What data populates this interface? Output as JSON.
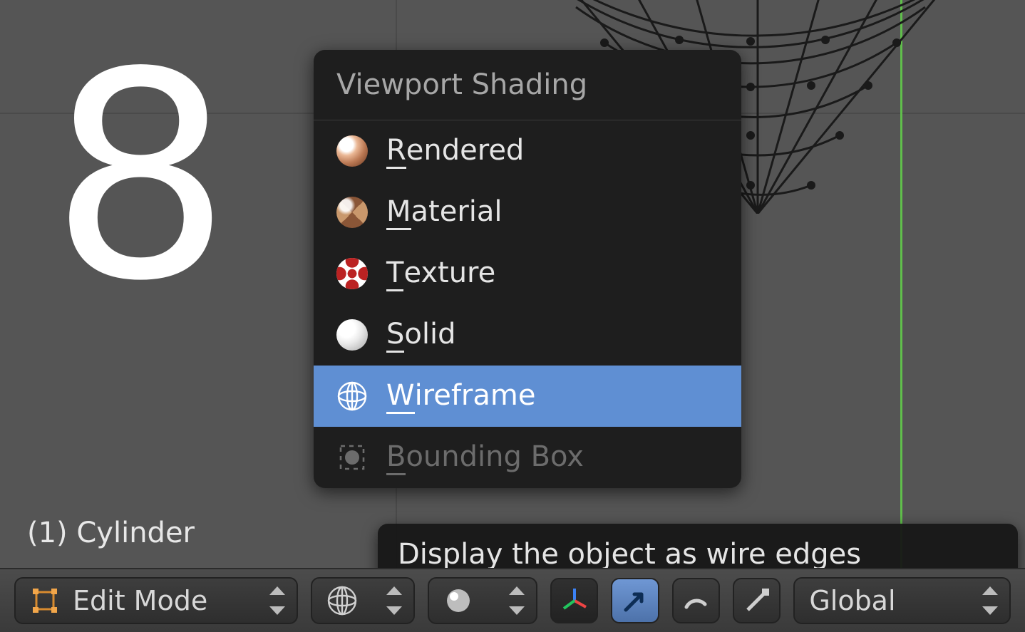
{
  "overlay_number": "8",
  "object_name": "(1) Cylinder",
  "popup": {
    "title": "Viewport Shading",
    "items": [
      {
        "label_pre": "",
        "ul": "R",
        "label_post": "endered",
        "icon": "rendered"
      },
      {
        "label_pre": "",
        "ul": "M",
        "label_post": "aterial",
        "icon": "material"
      },
      {
        "label_pre": "",
        "ul": "T",
        "label_post": "exture",
        "icon": "texture"
      },
      {
        "label_pre": "",
        "ul": "S",
        "label_post": "olid",
        "icon": "solid"
      },
      {
        "label_pre": "",
        "ul": "W",
        "label_post": "ireframe",
        "icon": "wire",
        "selected": true
      },
      {
        "label_pre": "",
        "ul": "B",
        "label_post": "ounding Box",
        "icon": "bbox",
        "disabled": true
      }
    ]
  },
  "tooltip": "Display the object as wire edges",
  "toolbar": {
    "mode_label": "Edit Mode",
    "orientation_label": "Global"
  }
}
